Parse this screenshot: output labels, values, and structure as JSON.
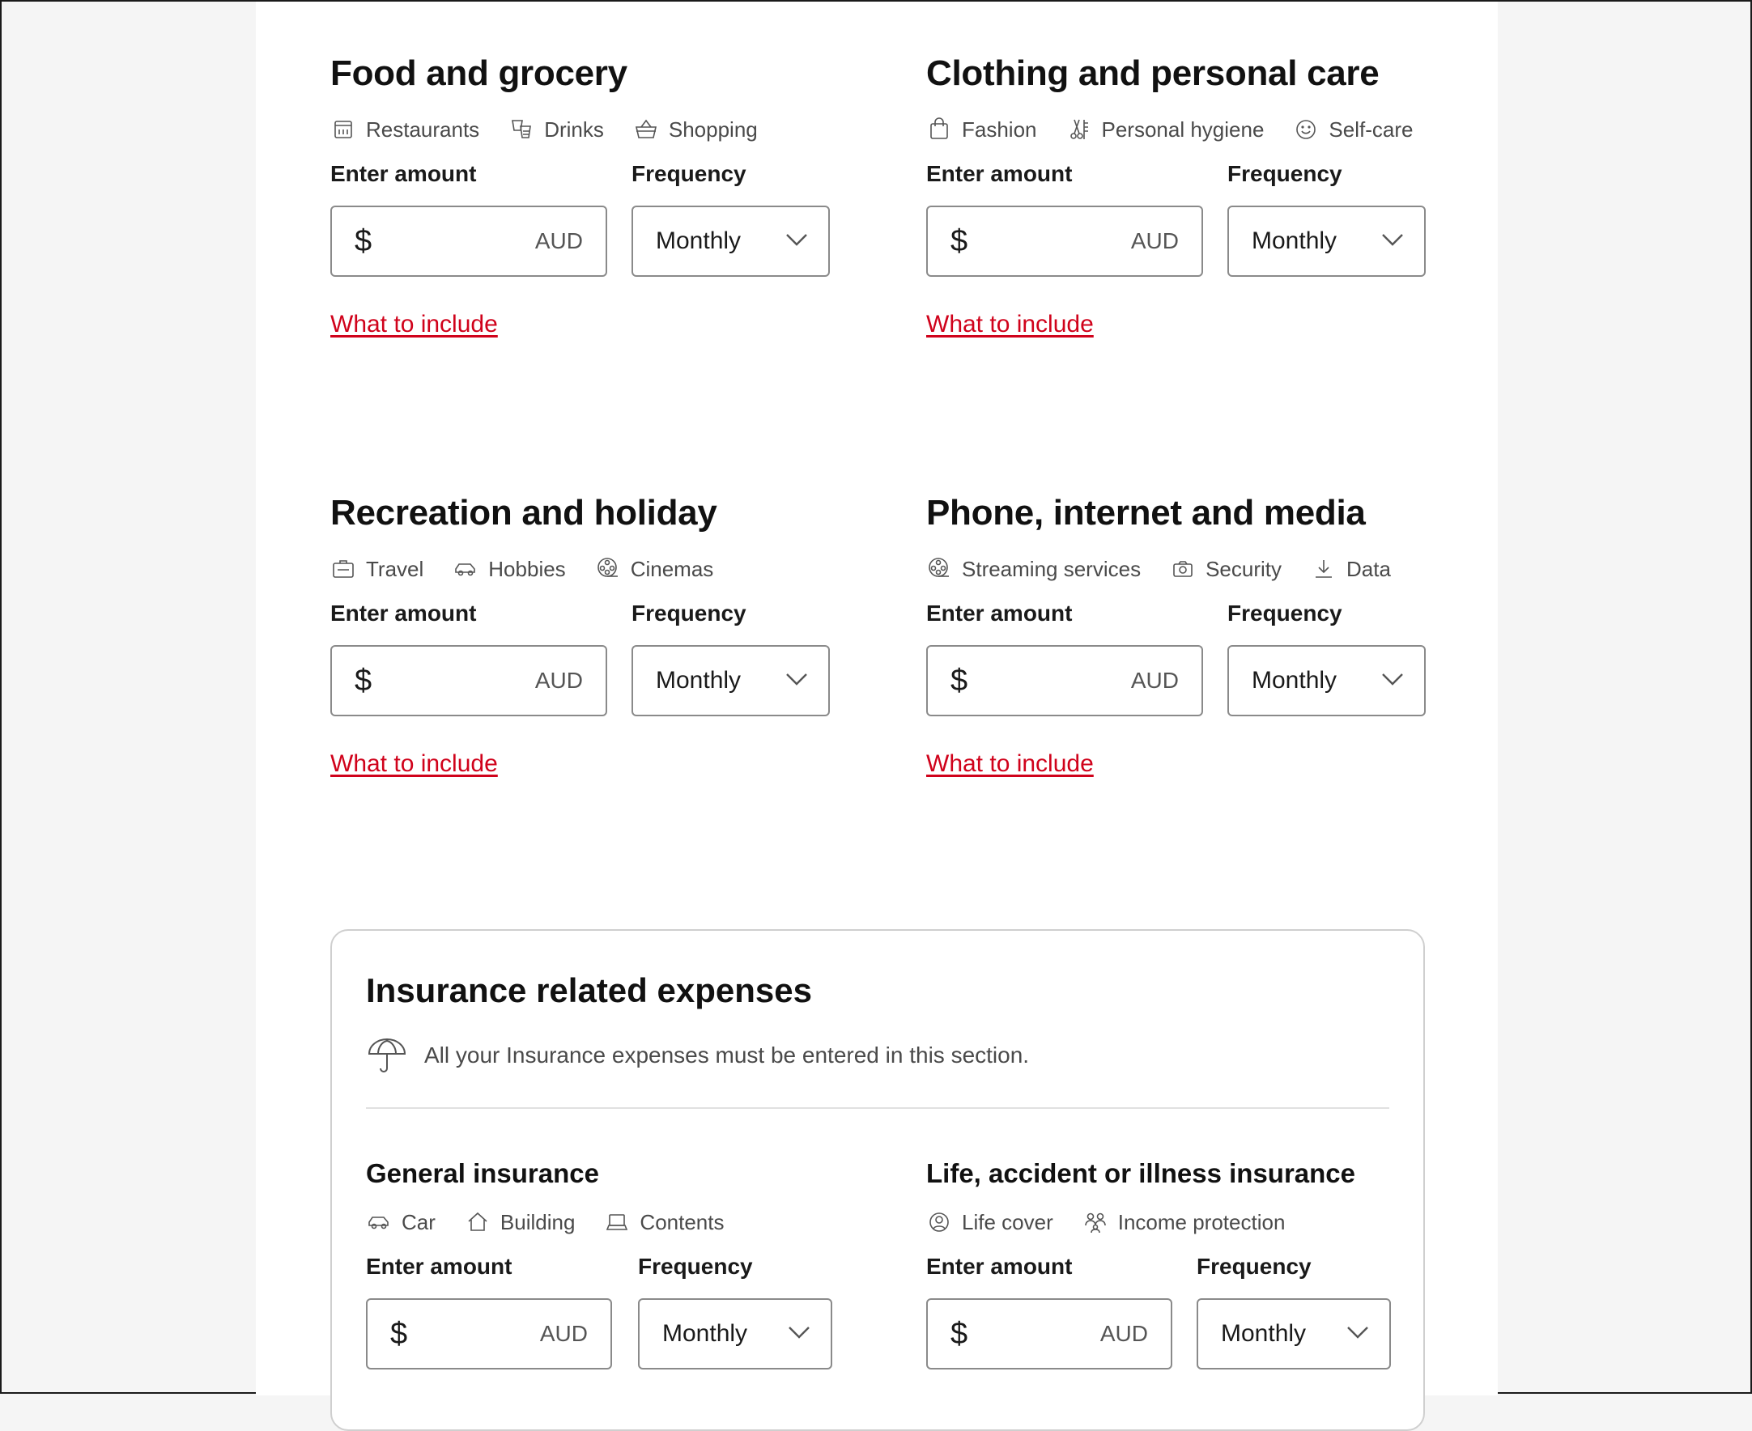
{
  "sections": [
    {
      "title": "Food and grocery",
      "tags": [
        {
          "icon": "restaurant-icon",
          "label": "Restaurants"
        },
        {
          "icon": "drinks-icon",
          "label": "Drinks"
        },
        {
          "icon": "basket-icon",
          "label": "Shopping"
        }
      ],
      "amount_label": "Enter amount",
      "currency_symbol": "$",
      "currency": "AUD",
      "frequency_label": "Frequency",
      "frequency": "Monthly",
      "link": "What to include"
    },
    {
      "title": "Clothing and personal care",
      "tags": [
        {
          "icon": "shopping-bag-icon",
          "label": "Fashion"
        },
        {
          "icon": "hygiene-icon",
          "label": "Personal hygiene"
        },
        {
          "icon": "smile-icon",
          "label": "Self-care"
        }
      ],
      "amount_label": "Enter amount",
      "currency_symbol": "$",
      "currency": "AUD",
      "frequency_label": "Frequency",
      "frequency": "Monthly",
      "link": "What to include"
    },
    {
      "title": "Recreation and holiday",
      "tags": [
        {
          "icon": "suitcase-icon",
          "label": "Travel"
        },
        {
          "icon": "car-icon",
          "label": "Hobbies"
        },
        {
          "icon": "film-reel-icon",
          "label": "Cinemas"
        }
      ],
      "amount_label": "Enter amount",
      "currency_symbol": "$",
      "currency": "AUD",
      "frequency_label": "Frequency",
      "frequency": "Monthly",
      "link": "What to include"
    },
    {
      "title": "Phone, internet and media",
      "tags": [
        {
          "icon": "streaming-icon",
          "label": "Streaming services"
        },
        {
          "icon": "camera-icon",
          "label": "Security"
        },
        {
          "icon": "download-icon",
          "label": "Data"
        }
      ],
      "amount_label": "Enter amount",
      "currency_symbol": "$",
      "currency": "AUD",
      "frequency_label": "Frequency",
      "frequency": "Monthly",
      "link": "What to include"
    }
  ],
  "insurance": {
    "title": "Insurance related expenses",
    "note": "All your Insurance expenses must be entered in this section.",
    "subsections": [
      {
        "title": "General insurance",
        "tags": [
          {
            "icon": "car-icon",
            "label": "Car"
          },
          {
            "icon": "house-icon",
            "label": "Building"
          },
          {
            "icon": "laptop-icon",
            "label": "Contents"
          }
        ],
        "amount_label": "Enter amount",
        "currency_symbol": "$",
        "currency": "AUD",
        "frequency_label": "Frequency",
        "frequency": "Monthly"
      },
      {
        "title": "Life, accident or illness insurance",
        "tags": [
          {
            "icon": "person-circle-icon",
            "label": "Life cover"
          },
          {
            "icon": "family-icon",
            "label": "Income protection"
          }
        ],
        "amount_label": "Enter amount",
        "currency_symbol": "$",
        "currency": "AUD",
        "frequency_label": "Frequency",
        "frequency": "Monthly"
      }
    ]
  }
}
